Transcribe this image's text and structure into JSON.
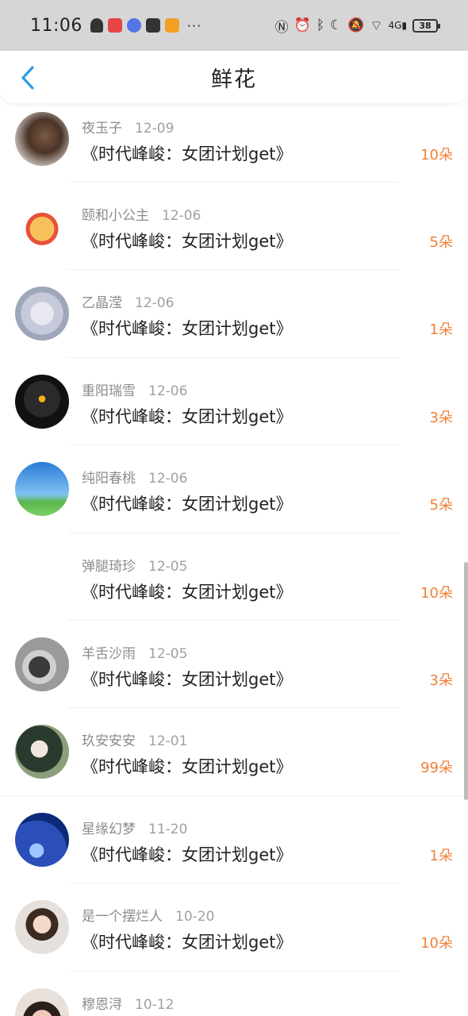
{
  "status_bar": {
    "time": "11:06",
    "more": "···",
    "battery": "38",
    "network": "4G"
  },
  "nav": {
    "title": "鲜花",
    "accent": "#2f9be8"
  },
  "colors": {
    "count": "#f0813a",
    "name": "#8c8c8c"
  },
  "items": [
    {
      "name": "夜玉子",
      "date": "12-09",
      "work": "《时代峰峻：女团计划get》",
      "count": "10朵"
    },
    {
      "name": "颐和小公主",
      "date": "12-06",
      "work": "《时代峰峻：女团计划get》",
      "count": "5朵"
    },
    {
      "name": "乙晶滢",
      "date": "12-06",
      "work": "《时代峰峻：女团计划get》",
      "count": "1朵"
    },
    {
      "name": "重阳瑞雪",
      "date": "12-06",
      "work": "《时代峰峻：女团计划get》",
      "count": "3朵"
    },
    {
      "name": "纯阳春桃",
      "date": "12-06",
      "work": "《时代峰峻：女团计划get》",
      "count": "5朵"
    },
    {
      "name": "弹腿琦珍",
      "date": "12-05",
      "work": "《时代峰峻：女团计划get》",
      "count": "10朵"
    },
    {
      "name": "羊舌沙雨",
      "date": "12-05",
      "work": "《时代峰峻：女团计划get》",
      "count": "3朵"
    },
    {
      "name": "玖安安安",
      "date": "12-01",
      "work": "《时代峰峻：女团计划get》",
      "count": "99朵"
    },
    {
      "name": "星缘幻梦",
      "date": "11-20",
      "work": "《时代峰峻：女团计划get》",
      "count": "1朵"
    },
    {
      "name": "是一个摆烂人",
      "date": "10-20",
      "work": "《时代峰峻：女团计划get》",
      "count": "10朵"
    },
    {
      "name": "穆恩浔",
      "date": "10-12",
      "work": "",
      "count": ""
    }
  ]
}
